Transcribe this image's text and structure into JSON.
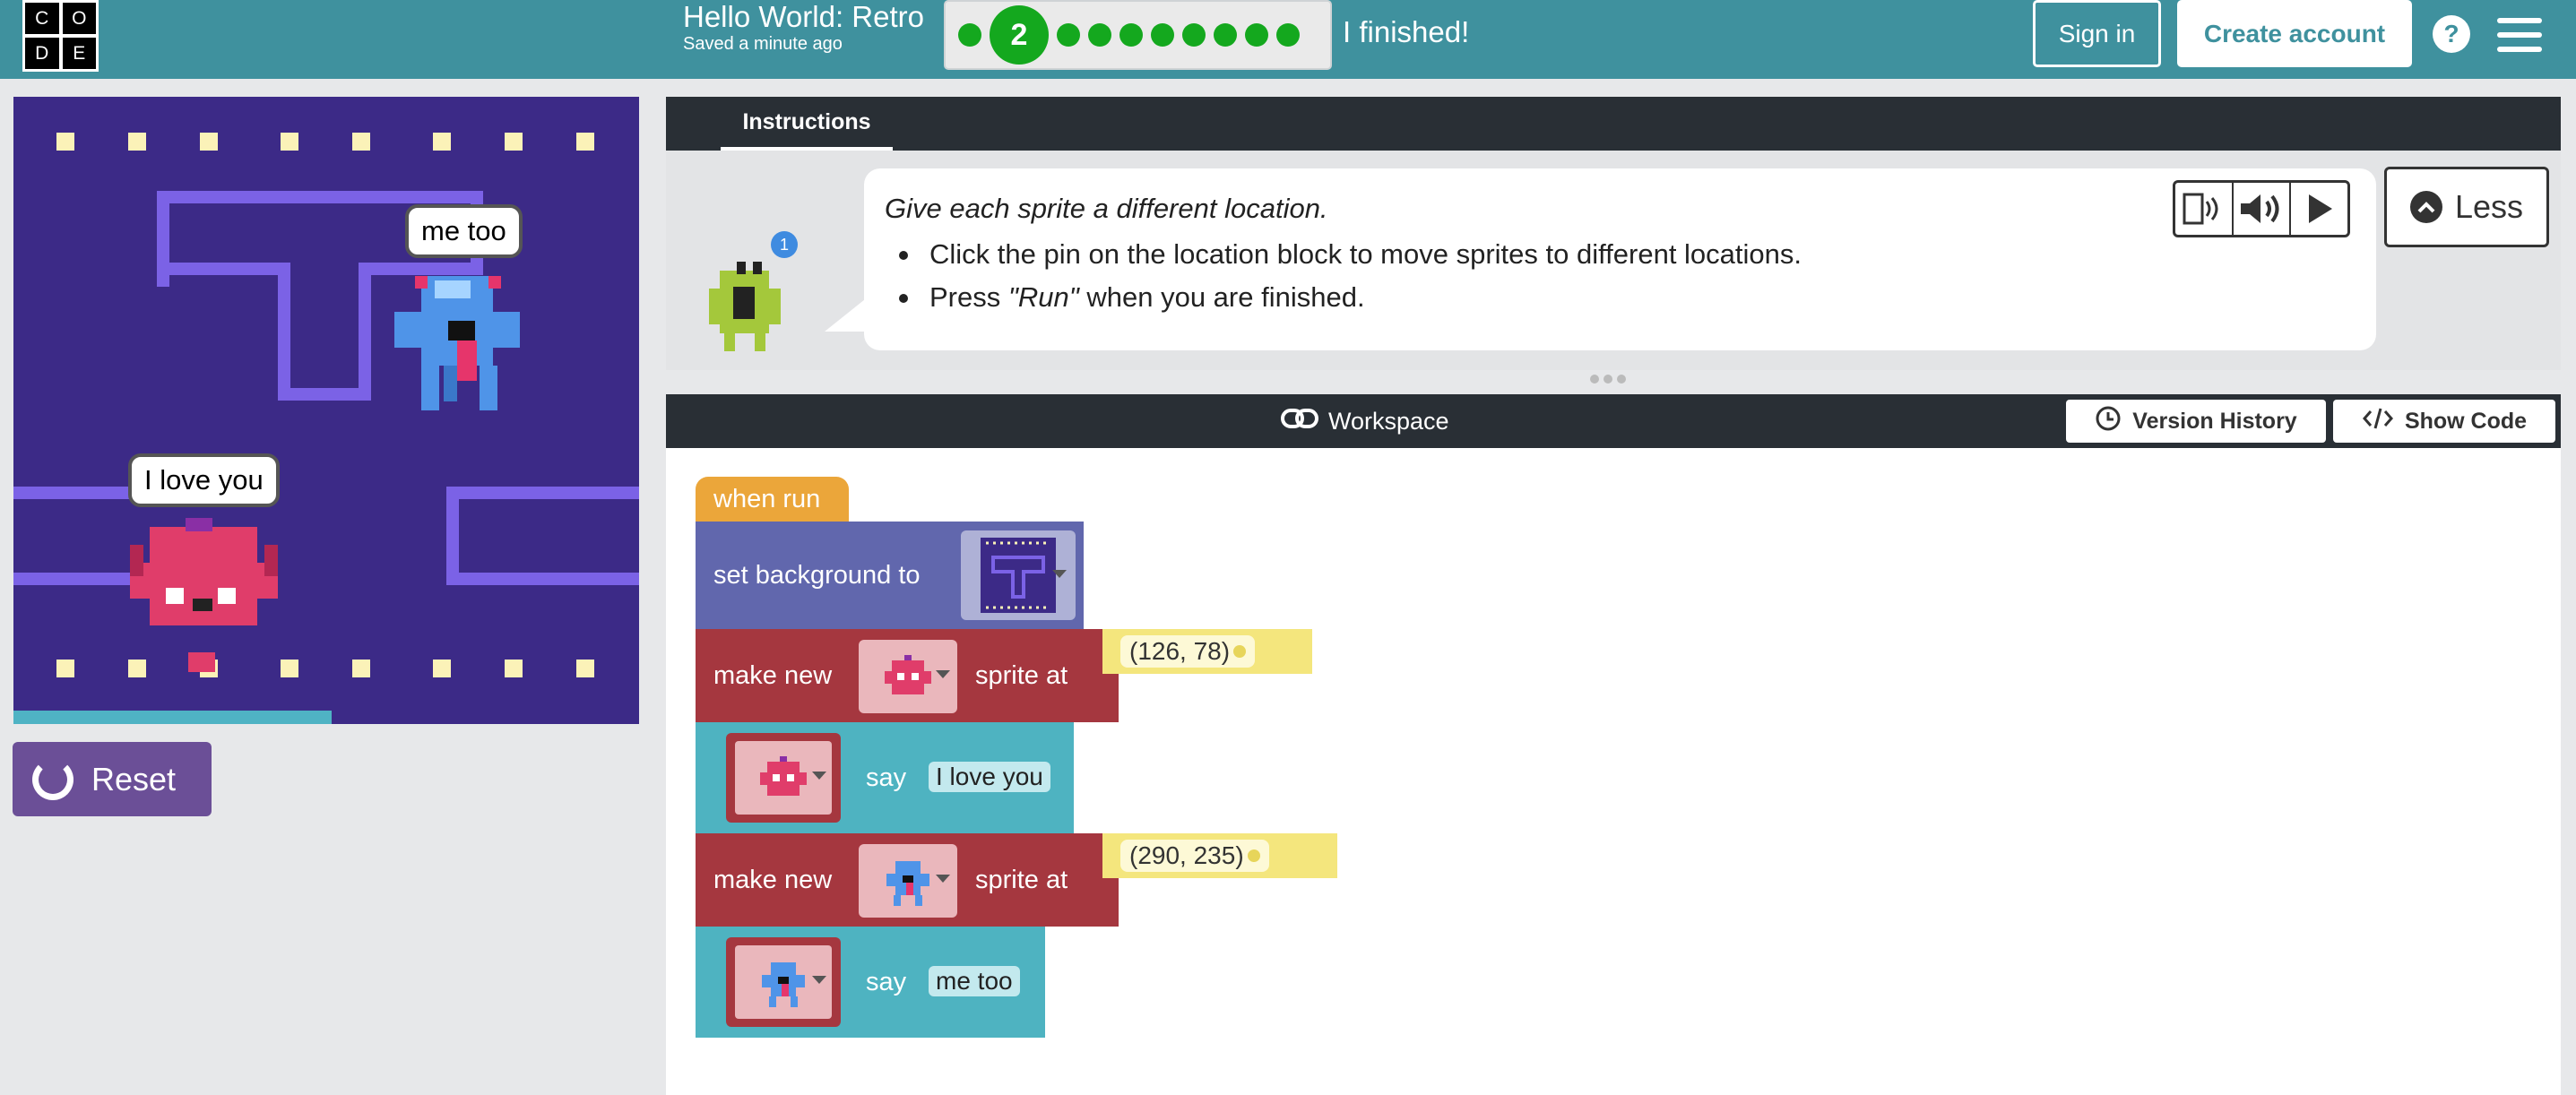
{
  "header": {
    "logo_letters": [
      "C",
      "O",
      "D",
      "E"
    ],
    "project_title": "Hello World: Retro",
    "saved_status": "Saved a minute ago",
    "progress": {
      "current_level": "2",
      "total_levels": 10
    },
    "finished_label": "I finished!",
    "sign_in_label": "Sign in",
    "create_account_label": "Create account",
    "help_label": "?"
  },
  "game": {
    "speech_1": "me too",
    "speech_2": "I love you",
    "reset_label": "Reset",
    "progress_fraction": 0.5
  },
  "instructions": {
    "tab_label": "Instructions",
    "heading": "Give each sprite a different location.",
    "bullet_1": "Click the pin on the location block to move sprites to different locations.",
    "bullet_2_prefix": "Press ",
    "bullet_2_emph": "\"Run\"",
    "bullet_2_suffix": " when you are finished.",
    "hint_count": "1",
    "less_label": "Less"
  },
  "workspace": {
    "title": "Workspace",
    "version_history_label": "Version History",
    "show_code_label": "Show Code",
    "blocks": {
      "when_run": "when run",
      "set_background": "set background to",
      "make_new_1": "make new",
      "sprite_at_1": "sprite at",
      "location_1": "(126, 78)",
      "say_1": "say",
      "say_1_text": "I love you",
      "make_new_2": "make new",
      "sprite_at_2": "sprite at",
      "location_2": "(290, 235)",
      "say_2": "say",
      "say_2_text": "me too"
    }
  },
  "colors": {
    "header": "#3f919e",
    "game_bg": "#3c2a87",
    "event_block": "#eba63a",
    "world_block": "#6167ad",
    "sprite_block": "#a5373f",
    "say_block": "#4eb3c1",
    "location_block": "#f4e67d",
    "reset": "#6b4f97"
  }
}
